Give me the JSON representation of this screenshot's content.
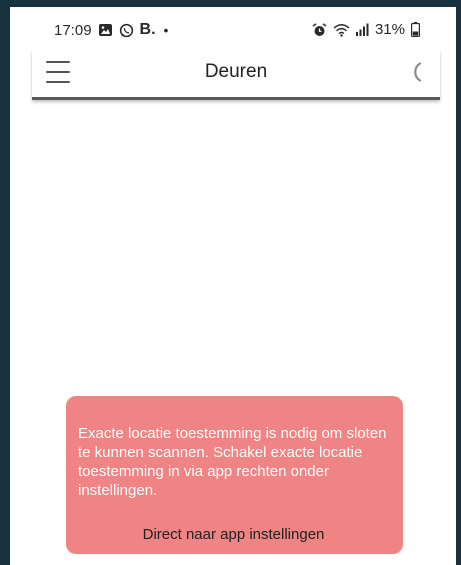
{
  "status_bar": {
    "time": "17:09",
    "carrier_letter": "B.",
    "dot": "•",
    "battery": "31%",
    "icons_left": [
      "gallery-icon",
      "whatsapp-icon"
    ],
    "icons_right": [
      "alarm-icon",
      "wifi-icon",
      "signal-icon",
      "battery-icon"
    ]
  },
  "app_bar": {
    "title": "Deuren",
    "menu_icon": "hamburger-menu-icon",
    "loading_icon": "loading-spinner-icon"
  },
  "snackbar": {
    "message": "Exacte locatie toestemming is nodig om sloten te kunnen scannen. Schakel exacte locatie toestemming in via app rechten onder instellingen.",
    "action_label": "Direct naar app instellingen",
    "background_color": "#f08383"
  }
}
